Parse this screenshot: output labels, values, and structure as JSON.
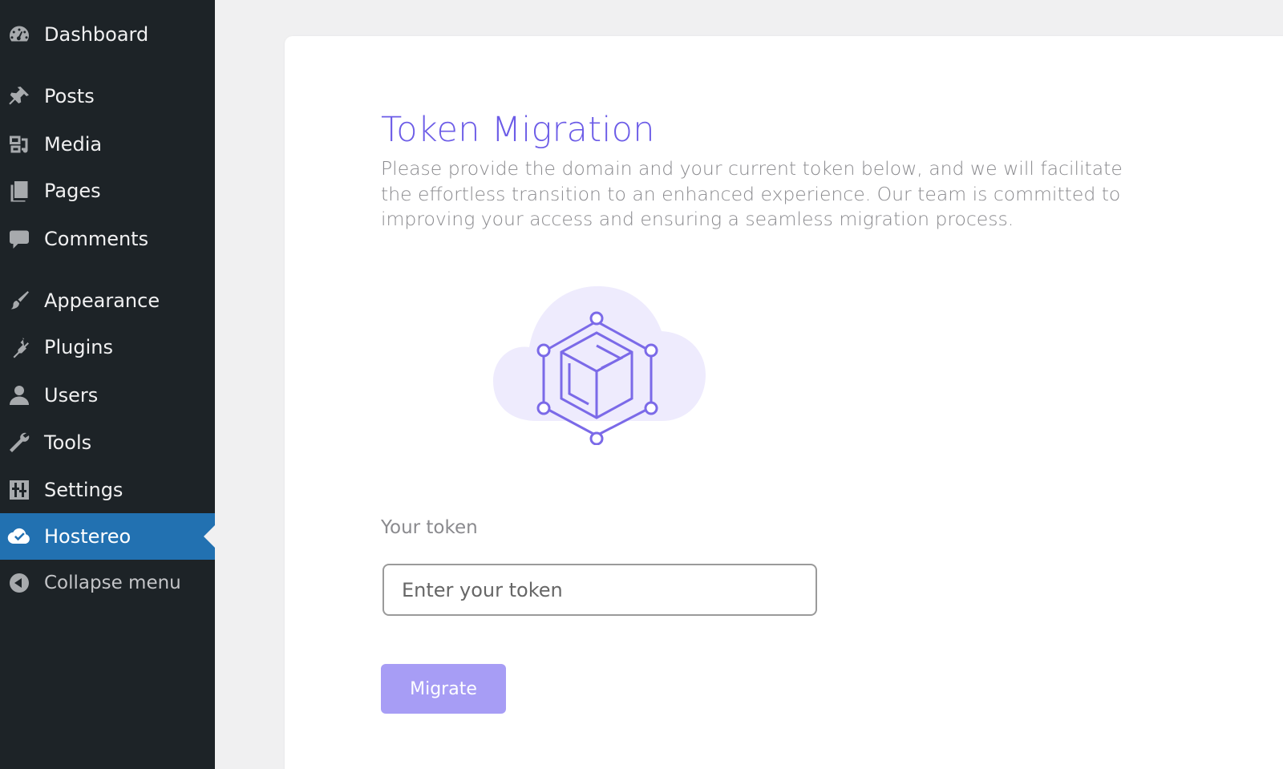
{
  "sidebar": {
    "items": [
      {
        "label": "Dashboard",
        "icon": "dashboard-icon"
      },
      {
        "label": "Posts",
        "icon": "pushpin-icon"
      },
      {
        "label": "Media",
        "icon": "media-icon"
      },
      {
        "label": "Pages",
        "icon": "pages-icon"
      },
      {
        "label": "Comments",
        "icon": "comment-icon"
      },
      {
        "label": "Appearance",
        "icon": "paintbrush-icon"
      },
      {
        "label": "Plugins",
        "icon": "plug-icon"
      },
      {
        "label": "Users",
        "icon": "user-icon"
      },
      {
        "label": "Tools",
        "icon": "wrench-icon"
      },
      {
        "label": "Settings",
        "icon": "sliders-icon"
      },
      {
        "label": "Hostereo",
        "icon": "cloud-check-icon",
        "active": true
      },
      {
        "label": "Collapse menu",
        "icon": "collapse-arrow-icon"
      }
    ]
  },
  "main": {
    "title": "Token Migration",
    "description": "Please provide the domain and your current token below, and we will facilitate the effortless transition to an enhanced experience. Our team is committed to improving your access and ensuring a seamless migration process.",
    "token_label": "Your token",
    "token_placeholder": "Enter your token",
    "token_value": "",
    "migrate_label": "Migrate"
  },
  "colors": {
    "sidebar_bg": "#1d2327",
    "active_bg": "#2271b1",
    "accent": "#6c5ce7",
    "button_bg": "#a79df5",
    "page_bg": "#f0f0f1"
  }
}
